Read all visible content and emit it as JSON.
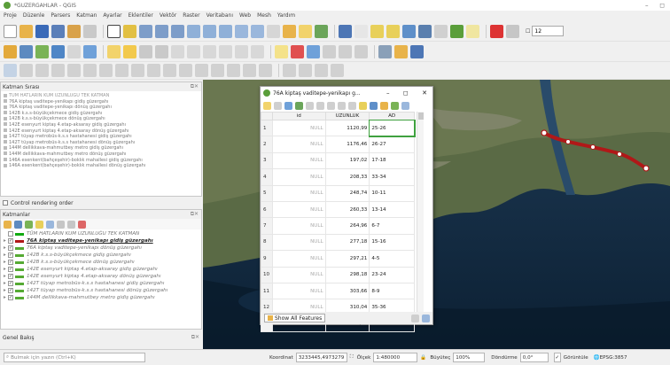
{
  "window": {
    "title": "*GUZERGAHLAR - QGIS",
    "minimize_symbol": "–",
    "restore_symbol": "◻"
  },
  "menu": [
    "Proje",
    "Düzenle",
    "Parsers",
    "Katman",
    "Ayarlar",
    "Eklentiler",
    "Vektör",
    "Raster",
    "Veritabanı",
    "Web",
    "Mesh",
    "Yardım"
  ],
  "toolbars": {
    "zoom_label": "☐",
    "zoom_value": "12"
  },
  "layer_order_panel": {
    "title": "Katman Sırası",
    "items": [
      "TÜM HATLARIN KUM UZUNLUĞU TEK KATMAN",
      "76A kiptaş vaditepe-yenikapı gidiş güzergahı",
      "76A kiptaş vaditepe-yenikapı dönüş güzergahı",
      "142B k.s.s-büyükçekmece gidiş güzergahı",
      "142B k.s.s-büyükçekmece dönüş güzergahı",
      "142E esenyurt kiptaş 4.etap-aksaray gidiş güzergahı",
      "142E esenyurt kiptaş 4.etap-aksaray dönüş güzergahı",
      "142T tüyap metrobüs-k.s.s hastahanesi gidiş güzergahı",
      "142T tüyap metrobüs-k.s.s hastahanesi dönüş güzergahı",
      "144M dellikkava-mahmutbey metro gidiş güzergahı",
      "144M dellikkava-mahmutbey metro dönüş güzergahı",
      "146A esenkent(bahçeşehir)-boklık mahallesi gidiş güzergahı",
      "146A esenkent(bahçeşehir)-boklık mahallesi dönüş güzergahı"
    ]
  },
  "control_rendering_order": "Control rendering order",
  "layers_panel": {
    "title": "Katmanlar",
    "items": [
      {
        "label": "TÜM HATLARIN KUM UZUNLUĞU TEK KATMAN",
        "checked": "",
        "kind": "group"
      },
      {
        "label": "76A kiptaş vaditepe-yenikapı gidiş güzergahı",
        "checked": "✓",
        "kind": "sel"
      },
      {
        "label": "76A kiptaş vaditepe-yenikapı dönüş güzergahı",
        "checked": "✓",
        "kind": ""
      },
      {
        "label": "142B k.s.s-büyükçekmece gidiş güzergahı",
        "checked": "✓",
        "kind": ""
      },
      {
        "label": "142B k.s.s-büyükçekmece dönüş güzergahı",
        "checked": "✓",
        "kind": ""
      },
      {
        "label": "142E esenyurt kiptaş 4.etap-aksaray gidiş güzergahı",
        "checked": "✓",
        "kind": ""
      },
      {
        "label": "142E esenyurt kiptaş 4.etap-aksaray dönüş güzergahı",
        "checked": "✓",
        "kind": ""
      },
      {
        "label": "142T tüyap metrobüs-k.s.s hastahanesi gidiş güzergahı",
        "checked": "✓",
        "kind": ""
      },
      {
        "label": "142T tüyap metrobüs-k.s.s hastahanesi dönüş güzergahı",
        "checked": "✓",
        "kind": ""
      },
      {
        "label": "144M dellikkava-mahmutbey metro gidiş güzergahı",
        "checked": "✓",
        "kind": ""
      }
    ]
  },
  "overview_panel": {
    "title": "Genel Bakış"
  },
  "attribute_table": {
    "title": "76A kiptaş vaditepe-yenikapı g...",
    "columns": [
      "id",
      "UZUNLUK",
      "AD"
    ],
    "rows": [
      {
        "n": "1",
        "id": "NULL",
        "uz": "1120,99",
        "ad": "25-26"
      },
      {
        "n": "2",
        "id": "NULL",
        "uz": "1176,46",
        "ad": "26-27"
      },
      {
        "n": "3",
        "id": "NULL",
        "uz": "197,02",
        "ad": "17-18"
      },
      {
        "n": "4",
        "id": "NULL",
        "uz": "208,33",
        "ad": "33-34"
      },
      {
        "n": "5",
        "id": "NULL",
        "uz": "248,74",
        "ad": "10-11"
      },
      {
        "n": "6",
        "id": "NULL",
        "uz": "260,33",
        "ad": "13-14"
      },
      {
        "n": "7",
        "id": "NULL",
        "uz": "264,96",
        "ad": "6-7"
      },
      {
        "n": "8",
        "id": "NULL",
        "uz": "277,18",
        "ad": "15-16"
      },
      {
        "n": "9",
        "id": "NULL",
        "uz": "297,21",
        "ad": "4-5"
      },
      {
        "n": "10",
        "id": "NULL",
        "uz": "298,18",
        "ad": "23-24"
      },
      {
        "n": "11",
        "id": "NULL",
        "uz": "303,66",
        "ad": "8-9"
      },
      {
        "n": "12",
        "id": "NULL",
        "uz": "310,04",
        "ad": "35-36"
      },
      {
        "n": "13",
        "id": "NULL",
        "uz": "332,70",
        "ad": "2-3"
      }
    ],
    "show_all": "Show All Features"
  },
  "statusbar": {
    "locator_placeholder": "Bulmak için yazın (Ctrl+K)",
    "coord_label": "Koordinat",
    "coord_value": "3233445,4973279",
    "scale_label": "Ölçek",
    "scale_value": "1:480000",
    "magnifier_label": "Büyüteç",
    "magnifier_value": "100%",
    "rotation_label": "Döndürme",
    "rotation_value": "0,0°",
    "render_label": "Görüntüle",
    "crs": "EPSG:3857"
  },
  "colors": {
    "route": "#b01818",
    "selection_green": "#3fa13f",
    "qgis_green": "#5a9e3a"
  }
}
